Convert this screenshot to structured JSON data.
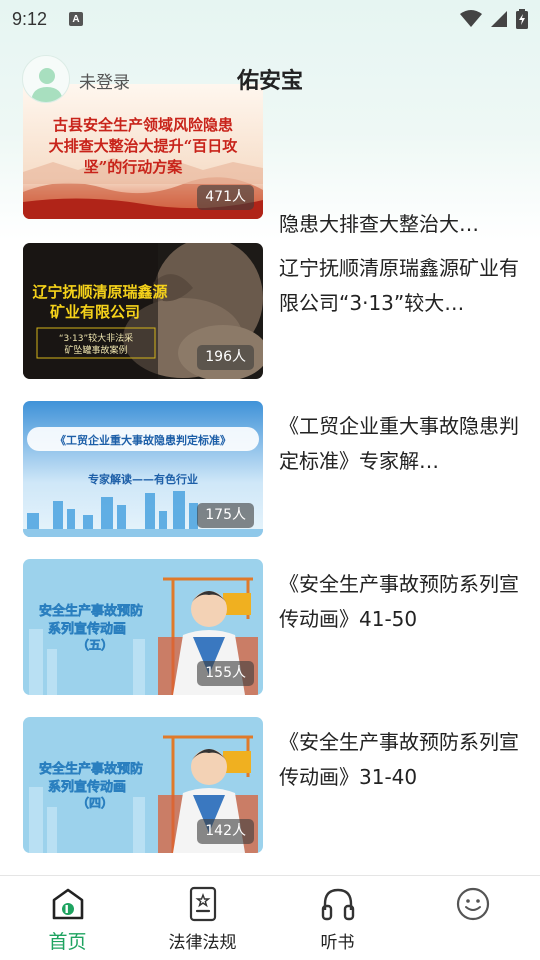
{
  "status_bar": {
    "time": "9:12",
    "indicator": "A"
  },
  "header": {
    "login_text": "未登录",
    "title": "佑安宝"
  },
  "items": [
    {
      "title": "隐患大排查大整治大…",
      "count": "471人",
      "thumb_lines": [
        "古县安全生产领域风险隐患",
        "大排查大整治大提升“百日攻",
        "坚”的行动方案"
      ]
    },
    {
      "title": "辽宁抚顺清原瑞鑫源矿业有限公司“3·13”较大…",
      "count": "196人",
      "thumb_lines": [
        "辽宁抚顺清原瑞鑫源",
        "矿业有限公司",
        "“3·13”较大非法采",
        "矿坠罐事故案例"
      ]
    },
    {
      "title": "《工贸企业重大事故隐患判定标准》专家解…",
      "count": "175人",
      "thumb_lines": [
        "《工贸企业重大事故隐患判定标准》",
        "专家解读——有色行业"
      ]
    },
    {
      "title": "《安全生产事故预防系列宣传动画》41-50",
      "count": "155人",
      "thumb_lines": [
        "安全生产事故预防",
        "系列宣传动画",
        "（五）"
      ]
    },
    {
      "title": "《安全生产事故预防系列宣传动画》31-40",
      "count": "142人",
      "thumb_lines": [
        "安全生产事故预防",
        "系列宣传动画",
        "（四）"
      ]
    }
  ],
  "nav": [
    {
      "label": "首页",
      "icon": "home-icon",
      "active": true
    },
    {
      "label": "法律法规",
      "icon": "document-icon",
      "active": false
    },
    {
      "label": "听书",
      "icon": "headphones-icon",
      "active": false
    },
    {
      "label": "",
      "icon": "face-icon",
      "active": false
    }
  ],
  "colors": {
    "accent": "#1ea360",
    "count_badge": "#3c3c3c",
    "header_tint": "#e6f5f2"
  }
}
